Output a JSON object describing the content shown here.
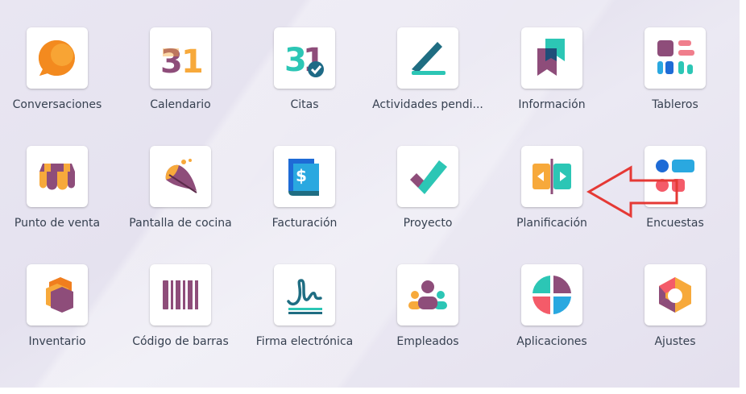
{
  "apps": [
    {
      "label": "Conversaciones",
      "icon": "chat-bubble-icon"
    },
    {
      "label": "Calendario",
      "icon": "calendar-31-icon"
    },
    {
      "label": "Citas",
      "icon": "appointment-31-check-icon"
    },
    {
      "label": "Actividades pendi...",
      "icon": "pen-todo-icon"
    },
    {
      "label": "Información",
      "icon": "bookmark-knowledge-icon"
    },
    {
      "label": "Tableros",
      "icon": "dashboard-blocks-icon"
    },
    {
      "label": "Punto de venta",
      "icon": "shop-awning-icon"
    },
    {
      "label": "Pantalla de cocina",
      "icon": "kitchen-feather-icon"
    },
    {
      "label": "Facturación",
      "icon": "invoice-dollar-icon"
    },
    {
      "label": "Proyecto",
      "icon": "project-check-icon"
    },
    {
      "label": "Planificación",
      "icon": "planning-arrows-icon"
    },
    {
      "label": "Encuestas",
      "icon": "survey-shapes-icon"
    },
    {
      "label": "Inventario",
      "icon": "inventory-hexagon-icon"
    },
    {
      "label": "Código de barras",
      "icon": "barcode-icon"
    },
    {
      "label": "Firma electrónica",
      "icon": "signature-icon"
    },
    {
      "label": "Empleados",
      "icon": "employees-icon"
    },
    {
      "label": "Aplicaciones",
      "icon": "apps-circle-icon"
    },
    {
      "label": "Ajustes",
      "icon": "settings-hexagon-icon"
    }
  ],
  "annotation": {
    "icon": "red-arrow-icon",
    "color": "#e53935"
  }
}
